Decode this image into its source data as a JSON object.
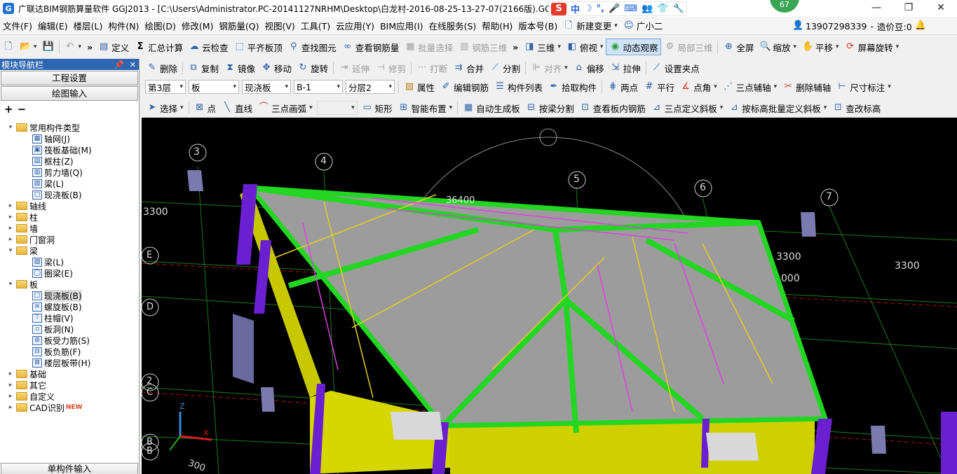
{
  "titlebar": {
    "title": "广联达BIM钢筋算量软件 GGJ2013 - [C:\\Users\\Administrator.PC-20141127NRHM\\Desktop\\白龙村-2016-08-25-13-27-07(2166版).GGJ12",
    "ime": [
      "中",
      "☽",
      "°,",
      "🎤",
      "⌨",
      "👥",
      "👕",
      "🔧"
    ],
    "badge": "67",
    "controls": [
      "—",
      "❐",
      "✕"
    ]
  },
  "menubar": {
    "items": [
      "文件(F)",
      "编辑(E)",
      "楼层(L)",
      "构件(N)",
      "绘图(D)",
      "修改(M)",
      "钢筋量(Q)",
      "视图(V)",
      "工具(T)",
      "云应用(Y)",
      "BIM应用(I)",
      "在线服务(S)",
      "帮助(H)",
      "版本号(B)"
    ],
    "new_change": "新建变更",
    "assistant": "广小二",
    "phone": "13907298339",
    "separator": "-",
    "price_beans": "造价豆:0"
  },
  "toolbar1": {
    "define": "定义",
    "sum": "汇总计算",
    "cloud_check": "云检查",
    "align_top": "平齐板顶",
    "find_elem": "查找图元",
    "view_rebar": "查看钢筋量",
    "batch_select": "批量选择",
    "rebar_3d": "钢筋三维",
    "view_3d": "三维",
    "top_view": "俯视",
    "dynamic_observe": "动态观察",
    "local_3d": "局部三维",
    "fullscreen": "全屏",
    "zoom": "缩放",
    "pan": "平移",
    "rotate_screen": "屏幕旋转"
  },
  "toolbar2": {
    "delete": "删除",
    "copy": "复制",
    "mirror": "镜像",
    "move": "移动",
    "rotate": "旋转",
    "extend": "延伸",
    "trim": "修剪",
    "break": "打断",
    "merge": "合并",
    "split": "分割",
    "align": "对齐",
    "offset": "偏移",
    "stretch": "拉伸",
    "set_grip": "设置夹点"
  },
  "toolbar3": {
    "floor": "第3层",
    "category": "板",
    "type": "现浇板",
    "name": "B-1",
    "layer": "分层2",
    "property": "属性",
    "edit_rebar": "编辑钢筋",
    "component_list": "构件列表",
    "pick_component": "拾取构件",
    "two_points": "两点",
    "parallel": "平行",
    "point_angle": "点角",
    "three_point_axis": "三点辅轴",
    "delete_axis": "删除辅轴",
    "dimension": "尺寸标注"
  },
  "toolbar4": {
    "select": "选择",
    "point": "点",
    "line": "直线",
    "arc3": "三点画弧",
    "rect": "矩形",
    "smart_layout": "智能布置",
    "auto_gen_slab": "自动生成板",
    "split_by_beam": "按梁分割",
    "view_slab_rebar": "查看板内钢筋",
    "three_point_slope": "三点定义斜板",
    "batch_slope_elev": "按标高批量定义斜板",
    "check_elev": "查改标高"
  },
  "nav": {
    "header": "模块导航栏",
    "header_btns": [
      "📌",
      "✕"
    ],
    "engineering_setup": "工程设置",
    "drawing_input": "绘图输入",
    "tools_plus": "+",
    "tools_minus": "−",
    "single_input": "单构件输入",
    "tree": [
      {
        "level": 0,
        "exp": "▾",
        "folder": true,
        "label": "常用构件类型"
      },
      {
        "level": 1,
        "icon": "▦",
        "label": "轴网(J)"
      },
      {
        "level": 1,
        "icon": "▣",
        "label": "筏板基础(M)"
      },
      {
        "level": 1,
        "icon": "▤",
        "label": "框柱(Z)"
      },
      {
        "level": 1,
        "icon": "▥",
        "label": "剪力墙(Q)"
      },
      {
        "level": 1,
        "icon": "▧",
        "label": "梁(L)"
      },
      {
        "level": 1,
        "icon": "□",
        "label": "现浇板(B)"
      },
      {
        "level": 0,
        "exp": "▸",
        "folder": true,
        "label": "轴线"
      },
      {
        "level": 0,
        "exp": "▸",
        "folder": true,
        "label": "柱"
      },
      {
        "level": 0,
        "exp": "▸",
        "folder": true,
        "label": "墙"
      },
      {
        "level": 0,
        "exp": "▸",
        "folder": true,
        "label": "门窗洞"
      },
      {
        "level": 0,
        "exp": "▾",
        "folder": true,
        "label": "梁"
      },
      {
        "level": 1,
        "icon": "▧",
        "label": "梁(L)"
      },
      {
        "level": 1,
        "icon": "◯",
        "label": "圈梁(E)"
      },
      {
        "level": 0,
        "exp": "▾",
        "folder": true,
        "label": "板"
      },
      {
        "level": 1,
        "icon": "□",
        "label": "现浇板(B)",
        "selected": true
      },
      {
        "level": 1,
        "icon": "≋",
        "label": "螺旋板(B)"
      },
      {
        "level": 1,
        "icon": "⊤",
        "label": "柱帽(V)"
      },
      {
        "level": 1,
        "icon": "▫",
        "label": "板洞(N)"
      },
      {
        "level": 1,
        "icon": "⊞",
        "label": "板受力筋(S)"
      },
      {
        "level": 1,
        "icon": "⊟",
        "label": "板负筋(F)"
      },
      {
        "level": 1,
        "icon": "⊠",
        "label": "楼层板带(H)"
      },
      {
        "level": 0,
        "exp": "▸",
        "folder": true,
        "label": "基础"
      },
      {
        "level": 0,
        "exp": "▸",
        "folder": true,
        "label": "其它"
      },
      {
        "level": 0,
        "exp": "▸",
        "folder": true,
        "label": "自定义"
      },
      {
        "level": 0,
        "exp": "▸",
        "folder": true,
        "label": "CAD识别",
        "new": "NEW"
      }
    ]
  },
  "viewport": {
    "axis_labels": [
      "3",
      "4",
      "5",
      "6",
      "7"
    ],
    "row_labels": [
      "E",
      "D",
      "2",
      "C",
      "B",
      "B"
    ],
    "dims": [
      "3300",
      "3300",
      "3300",
      "36400",
      "000",
      "300"
    ],
    "axis_triad": {
      "z": "Z",
      "x": "X"
    }
  }
}
